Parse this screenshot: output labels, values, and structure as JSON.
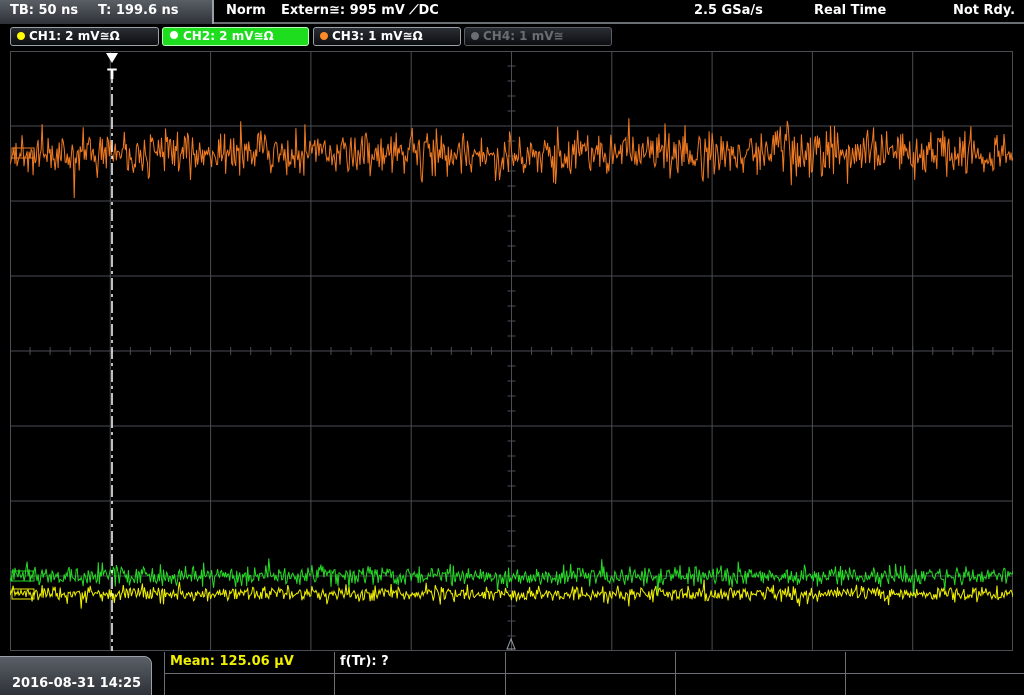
{
  "header": {
    "timebase": "TB: 50 ns",
    "trigger_time": "T: 199.6 ns",
    "trigger_mode": "Norm",
    "trigger_source": "Extern≅: 995 mV ⟋DC",
    "sample_rate": "2.5 GSa/s",
    "acq_mode": "Real Time",
    "status": "Not Rdy."
  },
  "channels": [
    {
      "label": "CH1: 2 mV≅Ω",
      "color": "#ffff00",
      "state": "on"
    },
    {
      "label": "CH2: 2 mV≅Ω",
      "color": "#22e822",
      "state": "active"
    },
    {
      "label": "CH3: 1 mV≅Ω",
      "color": "#ff8a2a",
      "state": "on"
    },
    {
      "label": "CH4: 1 mV≅",
      "color": "#6a6e74",
      "state": "off"
    }
  ],
  "screen": {
    "grid_color": "#4a4d52",
    "trigger_marker": "T",
    "traces": [
      {
        "channel": "CH3",
        "color": "#f07a22",
        "level_frac": 0.17,
        "amplitude_frac": 0.045
      },
      {
        "channel": "CH2",
        "color": "#26d926",
        "level_frac": 0.875,
        "amplitude_frac": 0.02
      },
      {
        "channel": "CH1",
        "color": "#f0f000",
        "level_frac": 0.905,
        "amplitude_frac": 0.015
      }
    ]
  },
  "footer": {
    "datetime": "2016-08-31 14:25",
    "measurements": [
      {
        "text": "Mean: 125.06 µV",
        "color": "#f0f000"
      },
      {
        "text": "f(Tr): ?",
        "color": "#ffffff"
      }
    ]
  }
}
